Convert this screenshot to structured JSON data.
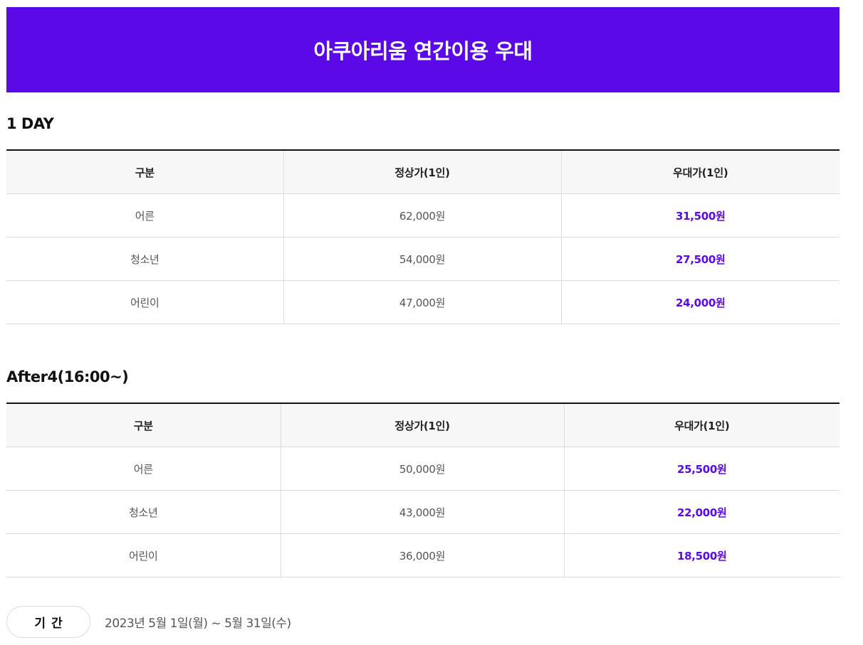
{
  "banner": {
    "title": "아쿠아리움 연간이용 우대"
  },
  "sections": [
    {
      "title": "1 DAY",
      "headers": [
        "구분",
        "정상가(1인)",
        "우대가(1인)"
      ],
      "rows": [
        {
          "category": "어른",
          "regular": "62,000원",
          "discount": "31,500원"
        },
        {
          "category": "청소년",
          "regular": "54,000원",
          "discount": "27,500원"
        },
        {
          "category": "어린이",
          "regular": "47,000원",
          "discount": "24,000원"
        }
      ]
    },
    {
      "title": "After4(16:00~)",
      "headers": [
        "구분",
        "정상가(1인)",
        "우대가(1인)"
      ],
      "rows": [
        {
          "category": "어른",
          "regular": "50,000원",
          "discount": "25,500원"
        },
        {
          "category": "청소년",
          "regular": "43,000원",
          "discount": "22,000원"
        },
        {
          "category": "어린이",
          "regular": "36,000원",
          "discount": "18,500원"
        }
      ]
    }
  ],
  "period": {
    "label": "기간",
    "value": "2023년 5월 1일(월) ~ 5월 31일(수)"
  },
  "colors": {
    "accent": "#5a0ae6",
    "header_bg": "#f7f7f7",
    "border": "#dcdcdc"
  }
}
